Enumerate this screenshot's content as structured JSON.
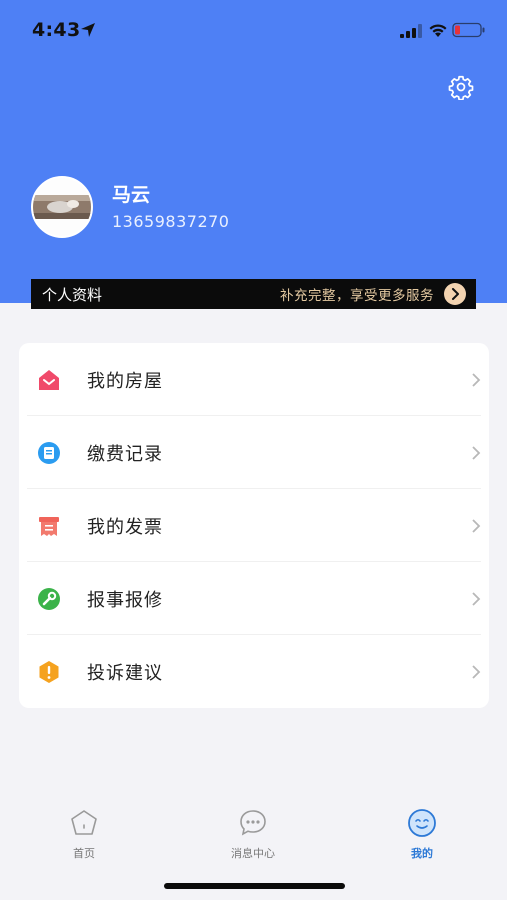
{
  "status_bar": {
    "time": "4:43"
  },
  "user": {
    "name": "马云",
    "phone": "13659837270"
  },
  "profile_bar": {
    "title": "个人资料",
    "hint": "补充完整，享受更多服务"
  },
  "menu": {
    "items": [
      {
        "label": "我的房屋",
        "icon": "house-icon",
        "color": "#f04a6a"
      },
      {
        "label": "缴费记录",
        "icon": "payment-record-icon",
        "color": "#2b9cf0"
      },
      {
        "label": "我的发票",
        "icon": "invoice-icon",
        "color": "#f0645a"
      },
      {
        "label": "报事报修",
        "icon": "wrench-icon",
        "color": "#3bb34a"
      },
      {
        "label": "投诉建议",
        "icon": "complaint-icon",
        "color": "#f5a21f"
      }
    ]
  },
  "tabbar": {
    "tabs": [
      {
        "label": "首页",
        "icon": "home-tab-icon",
        "active": false
      },
      {
        "label": "消息中心",
        "icon": "message-tab-icon",
        "active": false
      },
      {
        "label": "我的",
        "icon": "profile-tab-icon",
        "active": true
      }
    ]
  },
  "colors": {
    "header": "#4e80f5",
    "active_tab": "#2d79d6"
  }
}
